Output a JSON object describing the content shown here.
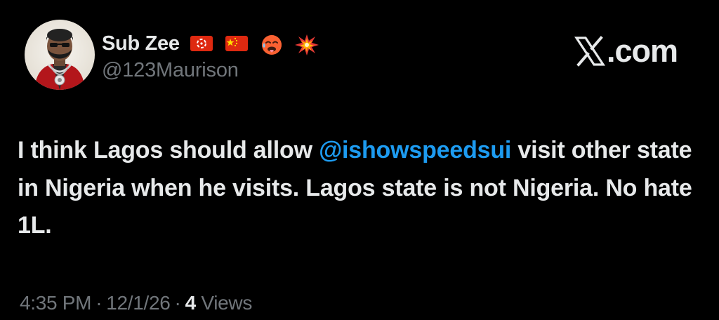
{
  "author": {
    "display_name": "Sub Zee",
    "handle": "@123Maurison",
    "name_emojis": [
      "hong-kong-flag",
      "china-flag",
      "hot-face-emoji",
      "collision-emoji"
    ]
  },
  "brand": {
    "icon": "x-logo-icon",
    "text": ".com"
  },
  "tweet": {
    "text_before": "I think Lagos should allow ",
    "mention": "@ishowspeedsui",
    "text_after": " visit other state in Nigeria when he visits. Lagos state is not Nigeria. No hate 1L."
  },
  "meta": {
    "time": "4:35 PM",
    "separator": "·",
    "date": "12/1/26",
    "views_count": "4",
    "views_label": "Views"
  },
  "colors": {
    "background": "#000000",
    "text_primary": "#e7e9ea",
    "text_secondary": "#71767b",
    "link": "#1d9bf0"
  }
}
